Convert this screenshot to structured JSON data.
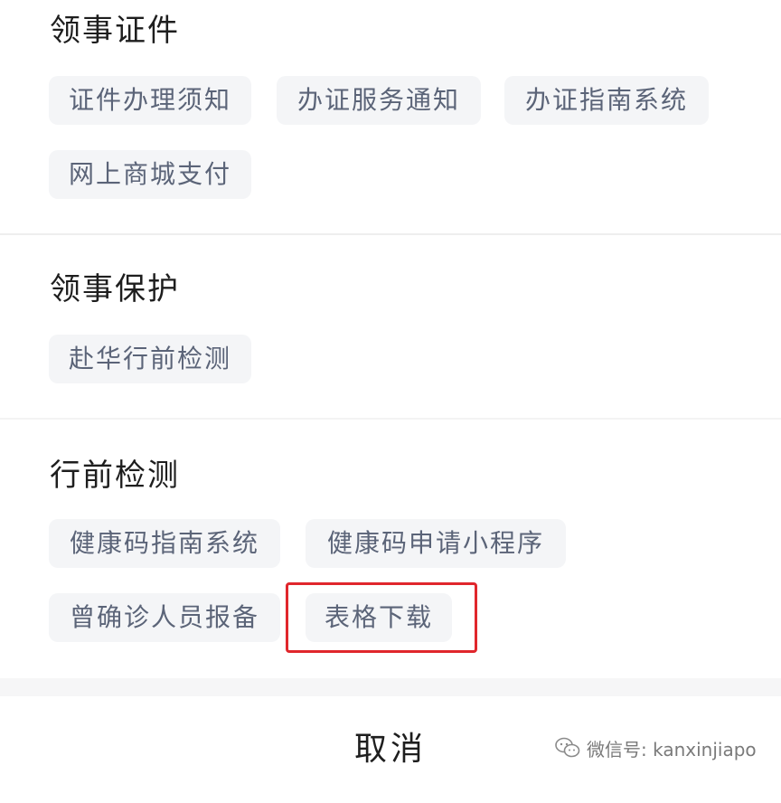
{
  "sections": [
    {
      "title": "领事证件",
      "items": [
        "证件办理须知",
        "办证服务通知",
        "办证指南系统",
        "网上商城支付"
      ]
    },
    {
      "title": "领事保护",
      "items": [
        "赴华行前检测"
      ]
    },
    {
      "title": "行前检测",
      "items": [
        "健康码指南系统",
        "健康码申请小程序",
        "曾确诊人员报备",
        "表格下载"
      ]
    }
  ],
  "cancel_label": "取消",
  "watermark": "微信号: kanxinjiapo",
  "highlight_color": "#e0262c"
}
